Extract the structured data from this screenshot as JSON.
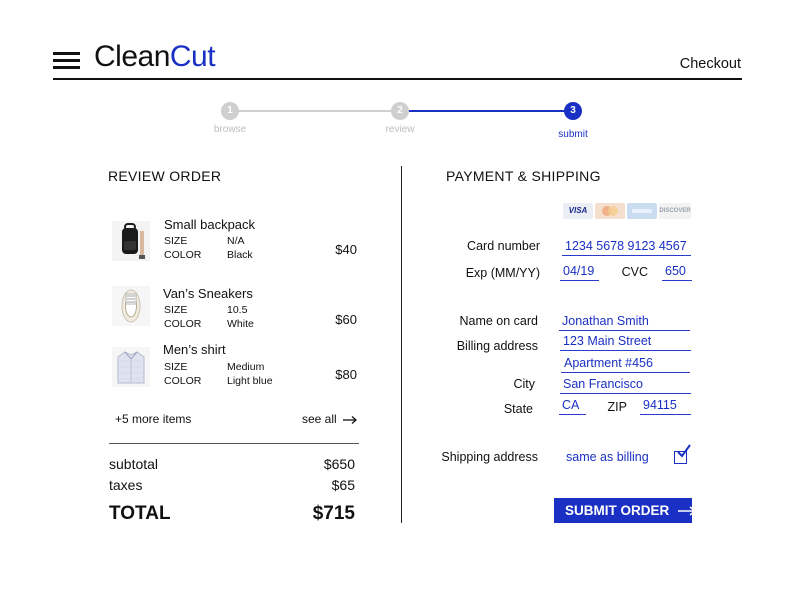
{
  "brand": {
    "part1": "Clean",
    "part2": "Cut",
    "accent": "#1a30c4"
  },
  "header": {
    "right_link": "Checkout"
  },
  "progress": {
    "steps": [
      {
        "number": "1",
        "label": "browse",
        "state": "done"
      },
      {
        "number": "2",
        "label": "review",
        "state": "done"
      },
      {
        "number": "3",
        "label": "submit",
        "state": "active"
      }
    ]
  },
  "review": {
    "title": "REVIEW ORDER",
    "items": [
      {
        "name": "Small backpack",
        "size_label": "SIZE",
        "size": "N/A",
        "color_label": "COLOR",
        "color": "Black",
        "price": "$40",
        "icon": "backpack-icon"
      },
      {
        "name": "Van’s Sneakers",
        "size_label": "SIZE",
        "size": "10.5",
        "color_label": "COLOR",
        "color": "White",
        "price": "$60",
        "icon": "sneaker-icon"
      },
      {
        "name": "Men’s shirt",
        "size_label": "SIZE",
        "size": "Medium",
        "color_label": "COLOR",
        "color": "Light blue",
        "price": "$80",
        "icon": "shirt-icon"
      }
    ],
    "more_items": "+5 more items",
    "see_all": "see all",
    "subtotal_label": "subtotal",
    "subtotal": "$650",
    "taxes_label": "taxes",
    "taxes": "$65",
    "total_label": "TOTAL",
    "total": "$715"
  },
  "payment": {
    "title": "PAYMENT & SHIPPING",
    "card_logos": [
      "VISA",
      "mastercard-icon",
      "amex-icon",
      "DISCOVER"
    ],
    "card_number_label": "Card number",
    "card_number": "1234 5678 9123 4567",
    "exp_label": "Exp (MM/YY)",
    "exp": "04/19",
    "cvc_label": "CVC",
    "cvc": "650",
    "name_label": "Name on card",
    "name": "Jonathan Smith",
    "billing_label": "Billing address",
    "billing_line1": "123 Main Street",
    "billing_line2": "Apartment #456",
    "city_label": "City",
    "city": "San Francisco",
    "state_label": "State",
    "state": "CA",
    "zip_label": "ZIP",
    "zip": "94115",
    "shipping_label": "Shipping address",
    "shipping_value": "same as billing",
    "shipping_checked": true,
    "submit_label": "SUBMIT ORDER"
  }
}
